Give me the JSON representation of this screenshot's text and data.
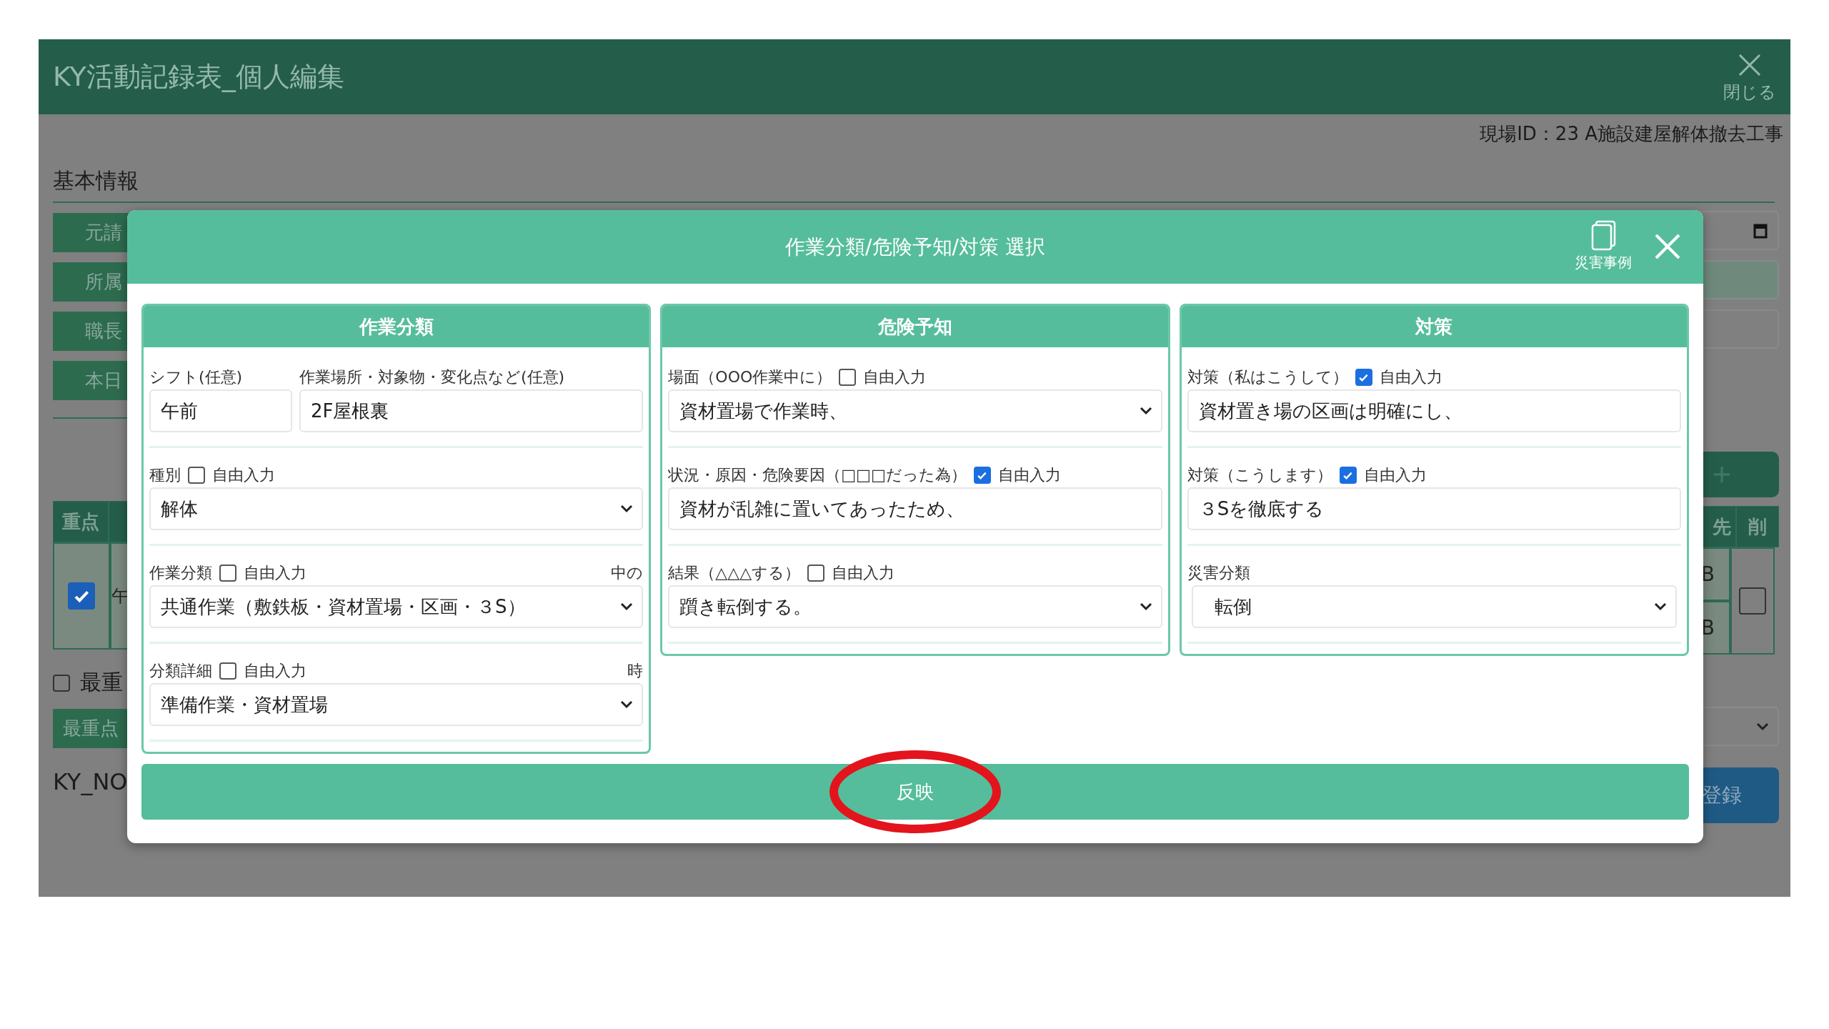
{
  "page": {
    "title": "KY活動記録表_個人編集",
    "close_label": "閉じる",
    "site_id": "現場ID：23 A施設建屋解体撤去工事",
    "section_title": "基本情報",
    "left_labels": [
      "元請",
      "所属",
      "職長",
      "本日"
    ],
    "table_header": "重点",
    "row_checked": true,
    "row_text": "午",
    "most_important": {
      "label": "最重",
      "checked": false
    },
    "most_important_button": "最重点",
    "ky_no": "KY_NO",
    "right_header": [
      "先",
      "削"
    ],
    "right_cells": [
      "B",
      "B"
    ],
    "delete_checked": false,
    "register_button": "登録"
  },
  "modal": {
    "title": "作業分類/危険予知/対策 選択",
    "case_label": "災害事例",
    "apply_button": "反映",
    "panels": [
      {
        "title": "作業分類",
        "groups": [
          {
            "kind": "pair",
            "fields": [
              {
                "label": "シフト(任意)",
                "value": "午前"
              },
              {
                "label": "作業場所・対象物・変化点など(任意)",
                "value": "2F屋根裏"
              }
            ]
          },
          {
            "kind": "select",
            "label": "種別",
            "free": {
              "label": "自由入力",
              "checked": false
            },
            "value": "解体"
          },
          {
            "kind": "select",
            "label": "作業分類",
            "free": {
              "label": "自由入力",
              "checked": false
            },
            "note": "中の",
            "value": "共通作業（敷鉄板・資材置場・区画・３S）"
          },
          {
            "kind": "select",
            "label": "分類詳細",
            "free": {
              "label": "自由入力",
              "checked": false
            },
            "note": "時",
            "value": "準備作業・資材置場"
          }
        ]
      },
      {
        "title": "危険予知",
        "groups": [
          {
            "kind": "select",
            "label": "場面（OOO作業中に）",
            "free": {
              "label": "自由入力",
              "checked": false
            },
            "value": "資材置場で作業時、"
          },
          {
            "kind": "input",
            "label": "状況・原因・危険要因（□□□だった為）",
            "free": {
              "label": "自由入力",
              "checked": true
            },
            "value": "資材が乱雑に置いてあったため、"
          },
          {
            "kind": "select",
            "label": "結果（△△△する）",
            "free": {
              "label": "自由入力",
              "checked": false
            },
            "value": "躓き転倒する。"
          }
        ]
      },
      {
        "title": "対策",
        "groups": [
          {
            "kind": "input",
            "label": "対策（私はこうして）",
            "free": {
              "label": "自由入力",
              "checked": true
            },
            "value": "資材置き場の区画は明確にし、"
          },
          {
            "kind": "input",
            "label": "対策（こうします）",
            "free": {
              "label": "自由入力",
              "checked": true
            },
            "value": "３Sを徹底する"
          },
          {
            "kind": "select",
            "label": "災害分類",
            "value": "転倒"
          }
        ]
      }
    ]
  }
}
